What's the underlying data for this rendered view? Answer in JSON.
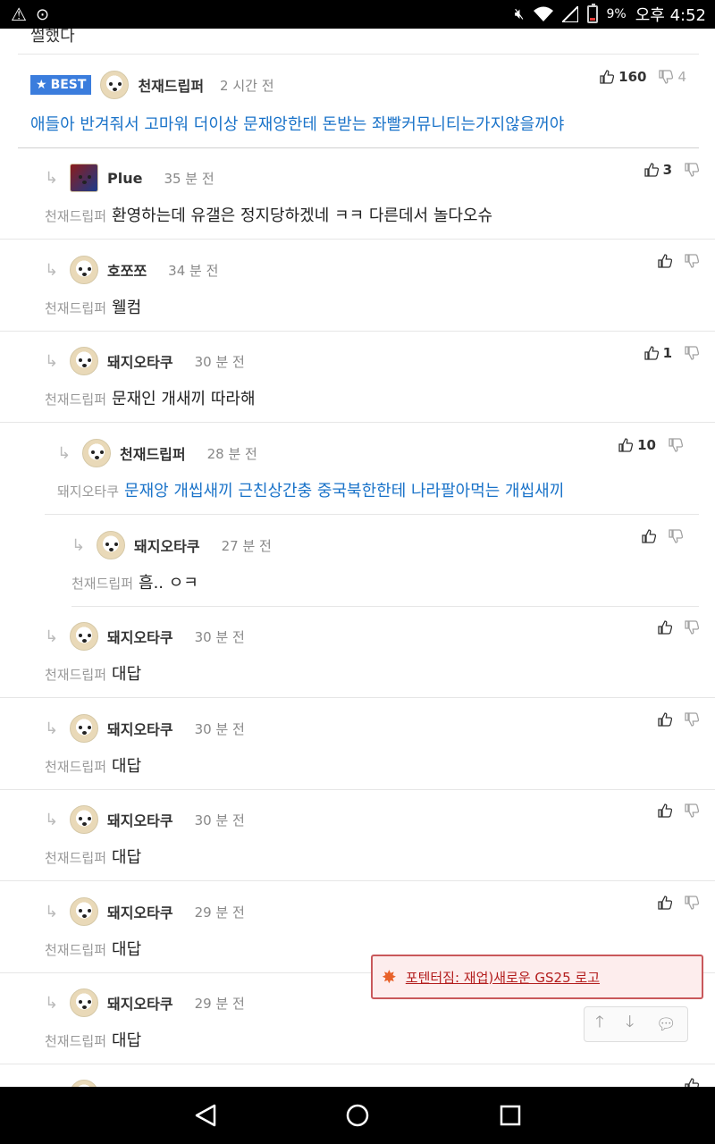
{
  "status": {
    "battery": "9%",
    "time": "오후 4:52"
  },
  "top_text": "썰했다",
  "best": {
    "badge": "BEST",
    "author": "천재드립퍼",
    "time": "2 시간 전",
    "up": "160",
    "down": "4",
    "text": "애들아 반겨줘서 고마워 더이상 문재앙한테 돈받는 좌빨커뮤니티는가지않을꺼야"
  },
  "comments": [
    {
      "author": "Plue",
      "time": "35 분 전",
      "up": "3",
      "mention": "천재드립퍼",
      "text": "환영하는데 유갤은 정지당하겠네 ㅋㅋ 다른데서 놀다오슈"
    },
    {
      "author": "호쪼쪼",
      "time": "34 분 전",
      "up": "",
      "mention": "천재드립퍼",
      "text": "웰컴"
    },
    {
      "author": "돼지오타쿠",
      "time": "30 분 전",
      "up": "1",
      "mention": "천재드립퍼",
      "text": "문재인 개새끼 따라해"
    },
    {
      "author": "천재드립퍼",
      "time": "28 분 전",
      "up": "10",
      "mention": "돼지오타쿠",
      "text": "문재앙 개씹새끼 근친상간충 중국북한한테 나라팔아먹는 개씹새끼"
    },
    {
      "author": "돼지오타쿠",
      "time": "27 분 전",
      "up": "",
      "mention": "천재드립퍼",
      "text": "흠.. ㅇㅋ"
    },
    {
      "author": "돼지오타쿠",
      "time": "30 분 전",
      "up": "",
      "mention": "천재드립퍼",
      "text": "대답"
    },
    {
      "author": "돼지오타쿠",
      "time": "30 분 전",
      "up": "",
      "mention": "천재드립퍼",
      "text": "대답"
    },
    {
      "author": "돼지오타쿠",
      "time": "30 분 전",
      "up": "",
      "mention": "천재드립퍼",
      "text": "대답"
    },
    {
      "author": "돼지오타쿠",
      "time": "29 분 전",
      "up": "",
      "mention": "천재드립퍼",
      "text": "대답"
    },
    {
      "author": "돼지오타쿠",
      "time": "29 분 전",
      "up": "",
      "mention": "천재드립퍼",
      "text": "대답"
    },
    {
      "author": "",
      "time": "",
      "up": "",
      "mention": "",
      "text": ""
    }
  ],
  "notice": {
    "link_text": "포텐터짐: 재업)새로운 GS25 로고"
  },
  "icons": {
    "upvote": "thumbs-up-icon",
    "downvote": "thumbs-down-icon",
    "reply": "reply-arrow-icon"
  }
}
